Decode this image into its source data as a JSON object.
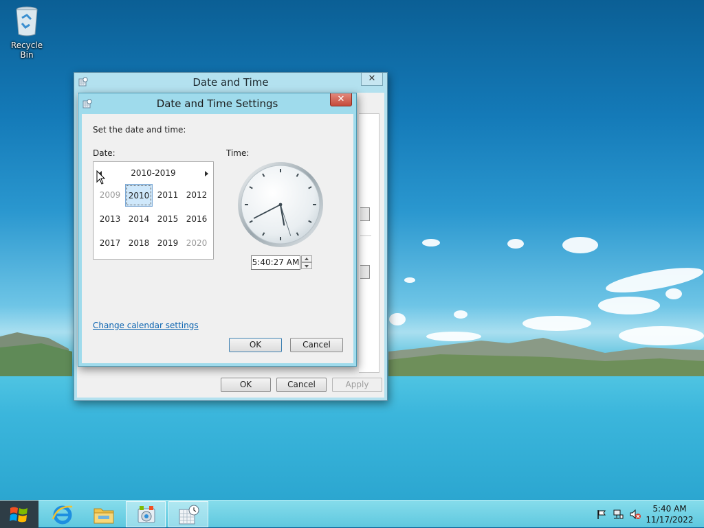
{
  "desktop": {
    "icons": [
      {
        "label": "Recycle Bin",
        "icon": "recycle-bin-icon"
      }
    ]
  },
  "outer_window": {
    "title": "Date and Time",
    "close_label": "✕",
    "buttons": {
      "ok": "OK",
      "cancel": "Cancel",
      "apply": "Apply"
    }
  },
  "dialog": {
    "title": "Date and Time Settings",
    "close_label": "✕",
    "instruction": "Set the date and time:",
    "date_label": "Date:",
    "time_label": "Time:",
    "calendar": {
      "range_title": "2010-2019",
      "years": [
        {
          "label": "2009",
          "state": "outside"
        },
        {
          "label": "2010",
          "state": "selected"
        },
        {
          "label": "2011",
          "state": "normal"
        },
        {
          "label": "2012",
          "state": "normal"
        },
        {
          "label": "2013",
          "state": "normal"
        },
        {
          "label": "2014",
          "state": "normal"
        },
        {
          "label": "2015",
          "state": "normal"
        },
        {
          "label": "2016",
          "state": "normal"
        },
        {
          "label": "2017",
          "state": "normal"
        },
        {
          "label": "2018",
          "state": "normal"
        },
        {
          "label": "2019",
          "state": "normal"
        },
        {
          "label": "2020",
          "state": "outside"
        }
      ]
    },
    "analog_clock": {
      "hours": 5,
      "minutes": 40,
      "seconds": 27
    },
    "time_value": "5:40:27 AM",
    "link": "Change calendar settings",
    "buttons": {
      "ok": "OK",
      "cancel": "Cancel"
    }
  },
  "taskbar": {
    "apps": [
      {
        "name": "internet-explorer-icon",
        "active": false
      },
      {
        "name": "file-explorer-icon",
        "active": false
      },
      {
        "name": "control-panel-icon",
        "active": true
      },
      {
        "name": "date-time-icon",
        "active": true
      }
    ],
    "tray": {
      "time": "5:40 AM",
      "date": "11/17/2022",
      "icons": [
        "action-center-flag-icon",
        "network-icon",
        "volume-muted-icon"
      ]
    }
  },
  "colors": {
    "accent": "#3c7fb1",
    "link": "#0a63b0",
    "close_red": "#c54b3b",
    "selected_year": "#cfe8fb"
  }
}
